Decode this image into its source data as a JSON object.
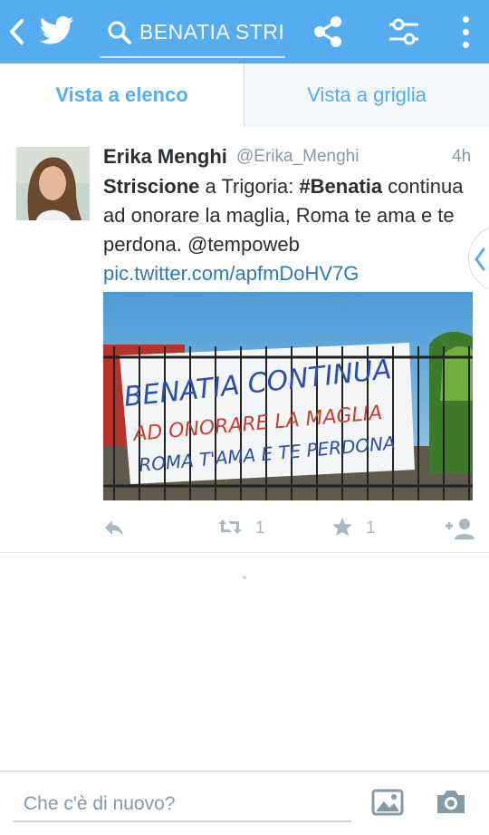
{
  "header": {
    "search_query": "BENATIA STRI",
    "icons": [
      "back-chevron-icon",
      "twitter-bird-icon",
      "search-icon",
      "share-icon",
      "filter-icon",
      "more-vert-icon"
    ],
    "accent": "#55acee"
  },
  "tabs": [
    {
      "label": "Vista a elenco",
      "active": true
    },
    {
      "label": "Vista a griglia",
      "active": false
    }
  ],
  "tweet": {
    "name": "Erika Menghi",
    "handle": "@Erika_Menghi",
    "time": "4h",
    "text": {
      "part1": "Striscione",
      "part2": " a Trigoria: ",
      "part3": "#Benatia",
      "part4": " continua ad onorare la maglia, Roma te ama e te perdona. @tempoweb ",
      "link": "pic.twitter.com/apfmDoHV7G"
    },
    "banner_text": {
      "line1": "BENATIA CONTINUA",
      "line2": "AD ONORARE LA MAGLIA",
      "line3": "ROMA T'AMA E TE PERDONA"
    },
    "retweets": "1",
    "favorites": "1"
  },
  "compose": {
    "placeholder": "Che c'è di nuovo?"
  }
}
